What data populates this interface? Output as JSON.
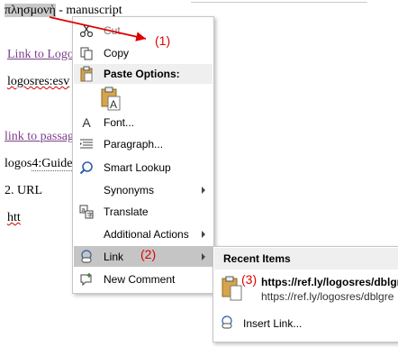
{
  "document": {
    "greek_word": "πλησμονὴ",
    "title_rest": " - manuscript",
    "line_link_logos": "Link to Logos",
    "line_logosres": "logosres:esv",
    "line_link_passage": "link to passag",
    "line_logos_guide_prefix": "logos",
    "line_logos_guide_suffix": "4:Guide",
    "line_url": "2. URL",
    "line_htt": "htt"
  },
  "context_menu": {
    "cut": "Cut",
    "copy": "Copy",
    "paste_options": "Paste Options:",
    "font": "Font...",
    "paragraph": "Paragraph...",
    "smart_lookup": "Smart Lookup",
    "synonyms": "Synonyms",
    "translate": "Translate",
    "additional_actions": "Additional Actions",
    "link": "Link",
    "new_comment": "New Comment"
  },
  "submenu": {
    "recent_items": "Recent Items",
    "recent_title": "https://ref.ly/logosres/dblgr",
    "recent_url": "https://ref.ly/logosres/dblgre",
    "insert_link": "Insert Link..."
  },
  "annotations": {
    "a1": "(1)",
    "a2": "(2)",
    "a3": "(3)"
  },
  "colors": {
    "annotation": "#e00000",
    "visited_link": "#7b3f8a",
    "highlight": "#c5c5c5"
  },
  "icons": [
    "scissors-icon",
    "copy-icon",
    "clipboard-icon",
    "font-icon",
    "paragraph-icon",
    "smart-lookup-icon",
    "translate-icon",
    "link-icon",
    "new-comment-icon",
    "insert-link-icon"
  ]
}
